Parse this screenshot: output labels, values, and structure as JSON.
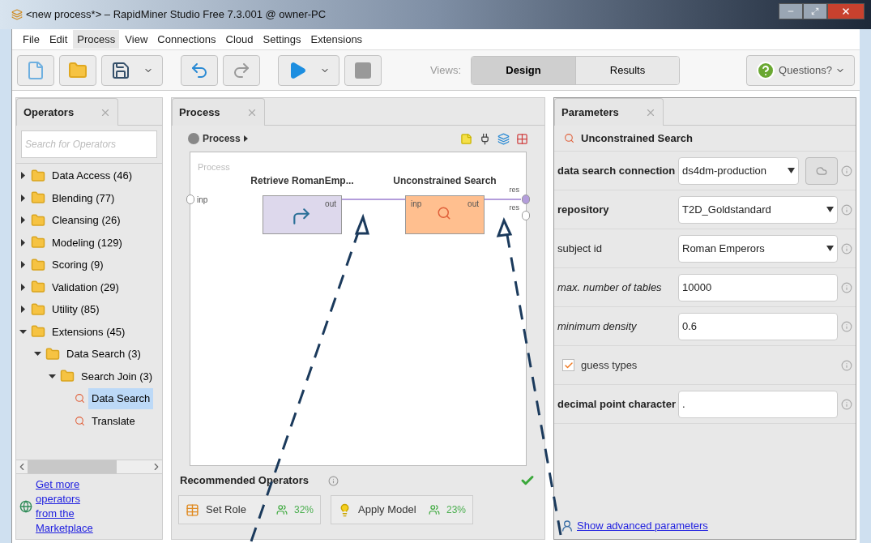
{
  "window": {
    "title": "<new process*> – RapidMiner Studio Free 7.3.001 @ owner-PC"
  },
  "menu": [
    {
      "label": "File",
      "selected": false
    },
    {
      "label": "Edit",
      "selected": false
    },
    {
      "label": "Process",
      "selected": true
    },
    {
      "label": "View",
      "selected": false
    },
    {
      "label": "Connections",
      "selected": false
    },
    {
      "label": "Cloud",
      "selected": false
    },
    {
      "label": "Settings",
      "selected": false
    },
    {
      "label": "Extensions",
      "selected": false
    }
  ],
  "toolbar": {
    "views_label": "Views:",
    "views": [
      {
        "label": "Design",
        "selected": true
      },
      {
        "label": "Results",
        "selected": false
      }
    ],
    "help": "Questions?",
    "redo_disabled": true,
    "stop_disabled": true
  },
  "operators_panel": {
    "title": "Operators",
    "search": {
      "placeholder": "Search for Operators"
    },
    "tree": [
      {
        "label": "Data Access (46)",
        "kind": "folder",
        "expanded": false,
        "selected": false
      },
      {
        "label": "Blending (77)",
        "kind": "folder",
        "expanded": false,
        "selected": false
      },
      {
        "label": "Cleansing (26)",
        "kind": "folder",
        "expanded": false,
        "selected": false
      },
      {
        "label": "Modeling (129)",
        "kind": "folder",
        "expanded": false,
        "selected": false
      },
      {
        "label": "Scoring (9)",
        "kind": "folder",
        "expanded": false,
        "selected": false
      },
      {
        "label": "Validation (29)",
        "kind": "folder",
        "expanded": false,
        "selected": false
      },
      {
        "label": "Utility (85)",
        "kind": "folder",
        "expanded": false,
        "selected": false
      },
      {
        "label": "Extensions (45)",
        "kind": "folder",
        "expanded": true,
        "selected": false,
        "children": [
          {
            "label": "Data Search (3)",
            "kind": "folder",
            "expanded": true,
            "selected": false,
            "children": [
              {
                "label": "Search Join (3)",
                "kind": "folder",
                "expanded": true,
                "selected": false,
                "children": [
                  {
                    "label": "Data Search",
                    "kind": "operator",
                    "selected": true
                  },
                  {
                    "label": "Translate",
                    "kind": "operator",
                    "selected": false
                  }
                ]
              }
            ]
          }
        ]
      }
    ],
    "marketplace_link": "Get more operators from the Marketplace"
  },
  "process_panel": {
    "title": "Process",
    "breadcrumb": "Process",
    "canvas_label": "Process",
    "input_port": "inp",
    "output_ports": [
      "res",
      "res"
    ],
    "operators": [
      {
        "name": "Retrieve RomanEmp...",
        "kind": "retrieve",
        "ports": [
          "out"
        ]
      },
      {
        "name": "Unconstrained Search",
        "kind": "search",
        "ports": [
          "inp",
          "out"
        ]
      }
    ],
    "recommended": {
      "title": "Recommended Operators",
      "items": [
        {
          "label": "Set Role",
          "kind": "table",
          "share": "32%"
        },
        {
          "label": "Apply Model",
          "kind": "bulb",
          "share": "23%"
        }
      ]
    }
  },
  "parameters_panel": {
    "title": "Parameters",
    "operator": "Unconstrained Search",
    "params": [
      {
        "label": "data search connection",
        "required": true,
        "expert": false,
        "kind": "select",
        "value": "ds4dm-production",
        "button": true
      },
      {
        "label": "repository",
        "required": true,
        "expert": false,
        "kind": "select",
        "value": "T2D_Goldstandard",
        "button": false
      },
      {
        "label": "subject id",
        "required": false,
        "expert": false,
        "kind": "select",
        "value": "Roman Emperors",
        "button": false
      },
      {
        "label": "max. number of tables",
        "required": false,
        "expert": true,
        "kind": "text",
        "value": "10000"
      },
      {
        "label": "minimum density",
        "required": false,
        "expert": true,
        "kind": "text",
        "value": "0.6"
      },
      {
        "label": "guess types",
        "required": false,
        "expert": false,
        "kind": "checkbox",
        "checked": true
      },
      {
        "label": "decimal point character",
        "required": true,
        "expert": false,
        "kind": "text",
        "value": "."
      }
    ],
    "advanced_link": "Show advanced parameters"
  }
}
